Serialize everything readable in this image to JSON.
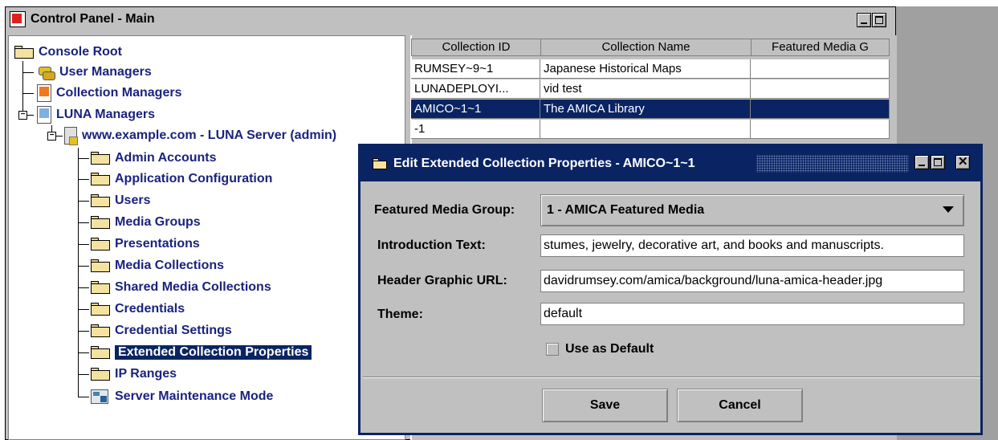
{
  "main_window": {
    "title": "Control Panel - Main"
  },
  "tree": {
    "root": "Console Root",
    "items": [
      {
        "label": "User Managers"
      },
      {
        "label": "Collection Managers"
      },
      {
        "label": "LUNA Managers"
      },
      {
        "label": "www.example.com - LUNA Server (admin)"
      },
      {
        "label": "Admin Accounts"
      },
      {
        "label": "Application Configuration"
      },
      {
        "label": "Users"
      },
      {
        "label": "Media Groups"
      },
      {
        "label": "Presentations"
      },
      {
        "label": "Media Collections"
      },
      {
        "label": "Shared Media Collections"
      },
      {
        "label": "Credentials"
      },
      {
        "label": "Credential Settings"
      },
      {
        "label": "Extended Collection Properties"
      },
      {
        "label": "IP Ranges"
      },
      {
        "label": "Server Maintenance Mode"
      }
    ],
    "selected": "Extended Collection Properties"
  },
  "table": {
    "columns": [
      "Collection ID",
      "Collection Name",
      "Featured Media G"
    ],
    "rows": [
      {
        "id": "RUMSEY~9~1",
        "name": "Japanese Historical Maps",
        "featured": ""
      },
      {
        "id": "LUNADEPLOYI...",
        "name": "vid test",
        "featured": ""
      },
      {
        "id": "AMICO~1~1",
        "name": "The AMICA Library",
        "featured": ""
      },
      {
        "id": "-1",
        "name": "",
        "featured": ""
      }
    ],
    "selected_row": "AMICO~1~1"
  },
  "dialog": {
    "title": "Edit Extended Collection Properties - AMICO~1~1",
    "featured_label": "Featured Media Group:",
    "featured_value": "1 - AMICA Featured Media",
    "intro_label": "Introduction Text:",
    "intro_value": "stumes, jewelry, decorative art, and books and manuscripts.",
    "header_label": "Header Graphic URL:",
    "header_value": "davidrumsey.com/amica/background/luna-amica-header.jpg",
    "theme_label": "Theme:",
    "theme_value": "default",
    "default_checkbox_label": "Use as Default",
    "default_checked": false,
    "save_label": "Save",
    "cancel_label": "Cancel"
  },
  "colors": {
    "selection": "#0a2463",
    "window": "#c0c0c0",
    "tree_text": "#1a237e"
  }
}
